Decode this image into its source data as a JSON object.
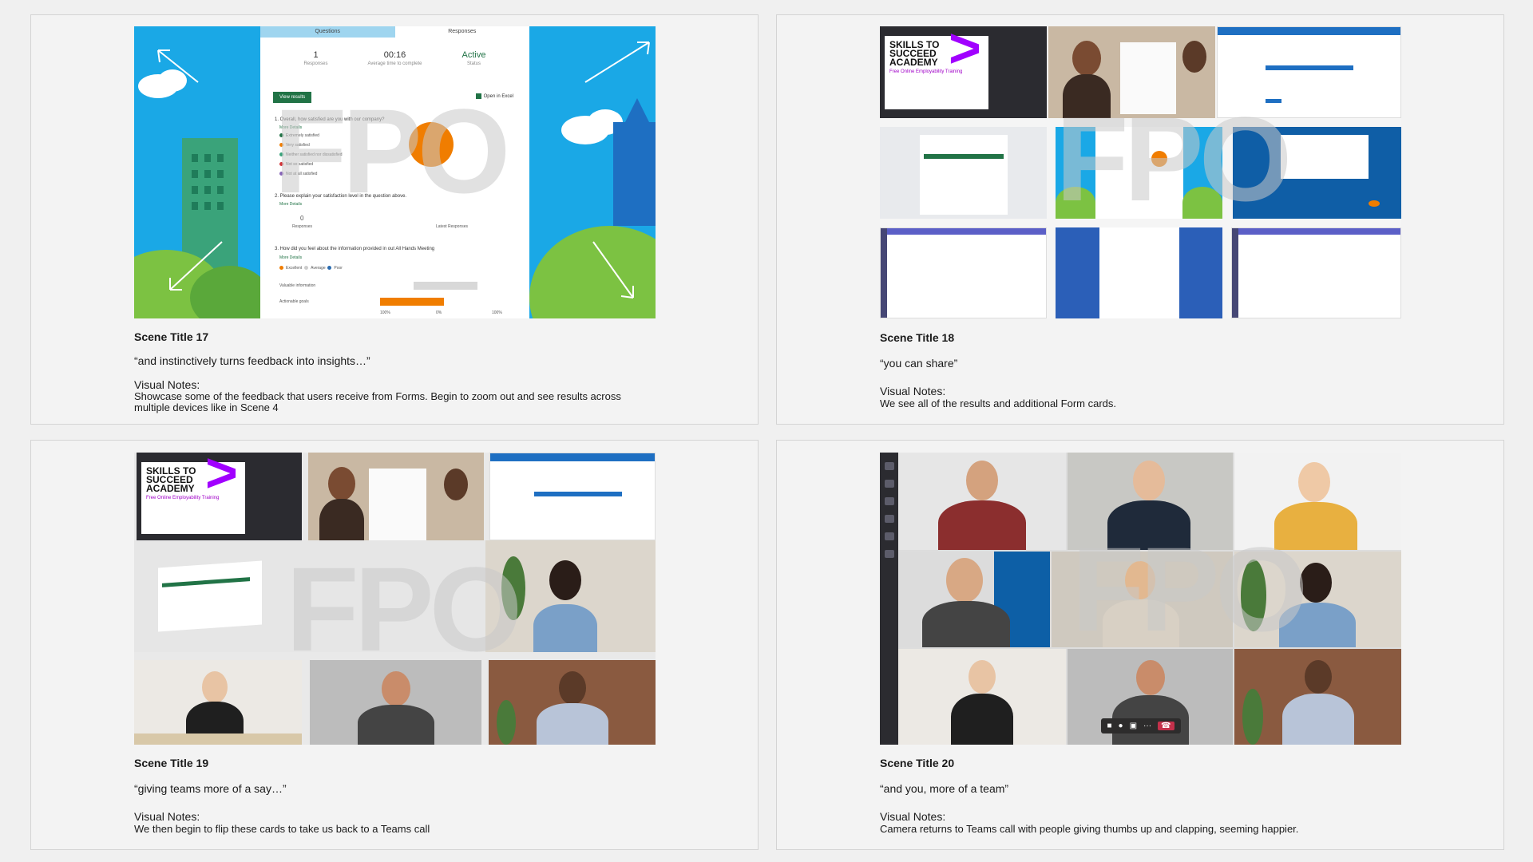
{
  "scenes": [
    {
      "title": "Scene Title 17",
      "quote": "“and instinctively turns feedback into insights…”",
      "notes_label": "Visual Notes:",
      "notes": "Showcase some of the feedback that users receive from Forms. Begin to zoom out and see results across multiple devices like in Scene 4",
      "watermark": "FPO",
      "form": {
        "tab_questions": "Questions",
        "tab_responses": "Responses",
        "stats": [
          {
            "value": "1",
            "label": "Responses"
          },
          {
            "value": "00:16",
            "label": "Average time to complete"
          },
          {
            "value": "Active",
            "label": "Status"
          }
        ],
        "view_results": "View results",
        "open_excel": "Open in Excel",
        "q1": "1.  Overall, how satisfied are you with our company?",
        "more_details": "More Details",
        "q1_options": [
          "Extremely satisfied",
          "Very satisfied",
          "Neither satisfied nor dissatisfied",
          "Not so satisfied",
          "Not at all satisfied"
        ],
        "q2": "2.  Please explain your satisfaction level in the question above.",
        "q2_count": "0",
        "q2_count_label": "Responses",
        "q2_latest": "Latest Responses",
        "q3": "3.  How did you feel about the information provided in out All Hands Meeting",
        "q3_legend": [
          "Excellent",
          "Average",
          "Poor"
        ],
        "q3_rows": [
          "Valuable information",
          "Actionable goals"
        ],
        "q3_axis": [
          "100%",
          "0%",
          "100%"
        ]
      }
    },
    {
      "title": "Scene Title 18",
      "quote": "“you can share”",
      "notes_label": "Visual Notes:",
      "notes": "We see all of the results and additional Form cards.",
      "watermark": "FPO",
      "skills_text": "SKILLS TO SUCCEED ACADEMY",
      "skills_sub": "Free Online Employability Training"
    },
    {
      "title": "Scene Title 19",
      "quote": "“giving teams more of a say…”",
      "notes_label": "Visual Notes:",
      "notes": "We then begin to flip these cards to take us back to a Teams call",
      "watermark": "FPO",
      "skills_text": "SKILLS TO SUCCEED ACADEMY",
      "skills_sub": "Free Online Employability Training"
    },
    {
      "title": "Scene Title 20",
      "quote": "“and you, more of a team”",
      "notes_label": "Visual Notes:",
      "notes": "Camera returns to Teams call with people giving thumbs up and clapping, seeming happier.",
      "watermark": "FPO"
    }
  ],
  "colors": {
    "sky": "#1aa8e6",
    "excel_green": "#217346",
    "accent_orange": "#f07d00",
    "accenture_purple": "#a100ff",
    "teams_red": "#c4314b"
  }
}
